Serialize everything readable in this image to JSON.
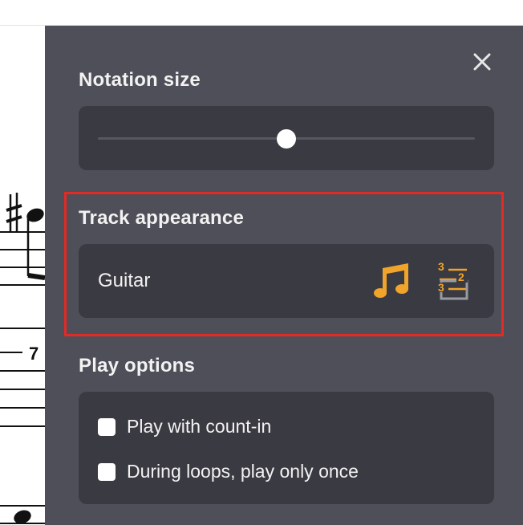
{
  "panel": {
    "close_icon": "close-icon",
    "notation_size": {
      "title": "Notation size",
      "slider_value": 0.5
    },
    "track_appearance": {
      "title": "Track appearance",
      "track_name": "Guitar",
      "standard_notation_icon": "music-note-icon",
      "tablature_icon": "tablature-icon",
      "tab_numbers": [
        "3",
        "2",
        "3"
      ],
      "accent_color": "#f0a42b"
    },
    "play_options": {
      "title": "Play options",
      "options": [
        {
          "label": "Play with count-in",
          "checked": false
        },
        {
          "label": "During loops, play only once",
          "checked": false
        }
      ]
    }
  },
  "score_fragment": {
    "fret_number": "7"
  },
  "colors": {
    "panel_bg": "#4f4f59",
    "card_bg": "#3a3a42",
    "highlight_border": "#e22b25"
  }
}
